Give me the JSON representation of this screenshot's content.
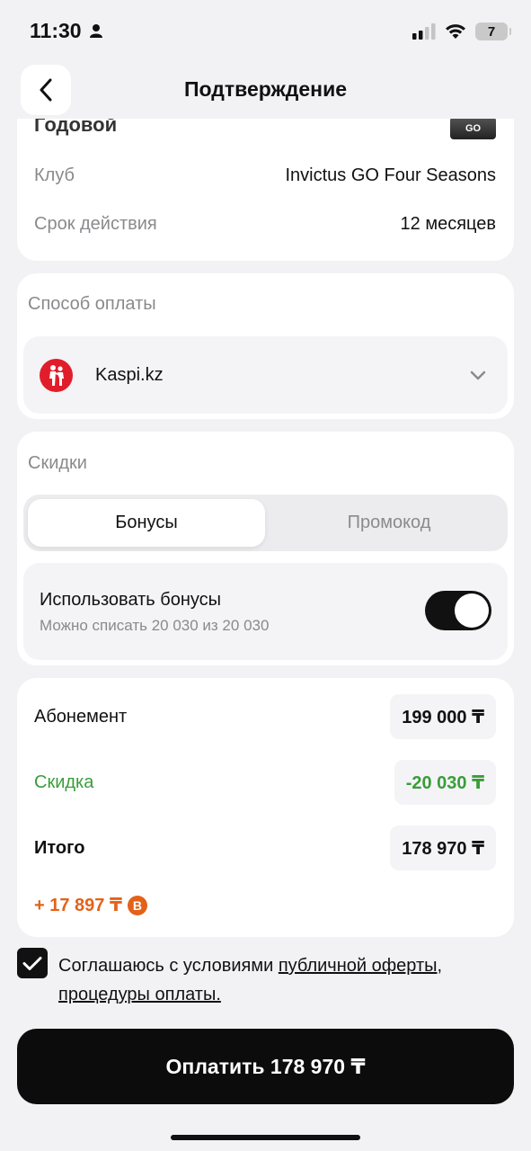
{
  "status": {
    "time": "11:30",
    "battery": "7"
  },
  "header": {
    "title": "Подтверждение"
  },
  "subscription": {
    "title": "Годовой",
    "badge": "GO",
    "club_label": "Клуб",
    "club_value": "Invictus GO Four Seasons",
    "term_label": "Срок действия",
    "term_value": "12 месяцев"
  },
  "payment": {
    "section_label": "Способ оплаты",
    "method": "Kaspi.kz"
  },
  "discounts": {
    "section_label": "Скидки",
    "tabs": [
      {
        "label": "Бонусы",
        "active": true
      },
      {
        "label": "Промокод",
        "active": false
      }
    ],
    "bonus_title": "Использовать бонусы",
    "bonus_sub": "Можно списать 20 030 из 20 030",
    "bonus_enabled": true
  },
  "summary": {
    "subscription_label": "Абонемент",
    "subscription_value": "199 000 ₸",
    "discount_label": "Скидка",
    "discount_value": "-20 030 ₸",
    "total_label": "Итого",
    "total_value": "178 970 ₸",
    "cashback": "+ 17 897 ₸",
    "cashback_icon": "B"
  },
  "agreement": {
    "checked": true,
    "text": "Соглашаюсь с условиями ",
    "link1": "публичной оферты",
    "sep": ", ",
    "link2": "процедуры оплаты."
  },
  "pay_button": {
    "label": "Оплатить 178 970 ₸"
  },
  "colors": {
    "accent": "#0c0c0c",
    "discount": "#3a9d3a",
    "cashback": "#e3621a",
    "kaspi": "#e21d2b"
  }
}
